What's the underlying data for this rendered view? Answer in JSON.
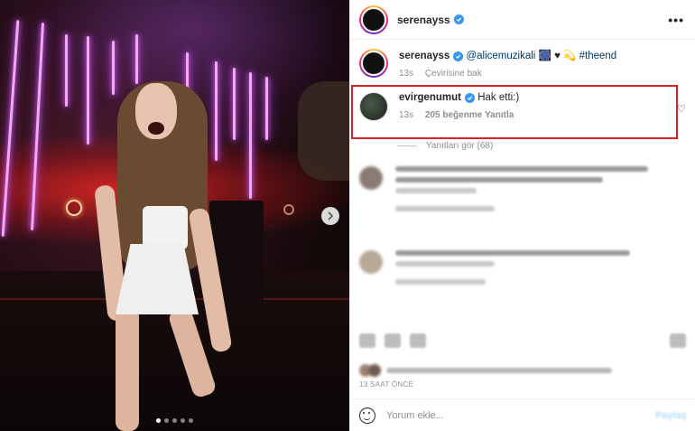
{
  "post": {
    "username": "serenayss",
    "more_icon": "more-horizontal-icon",
    "carousel_dots_total": 5,
    "carousel_dots_active": 1
  },
  "caption": {
    "username": "serenayss",
    "mention": "@alicemuzikali",
    "emojis": "🎆 ♥ 💫",
    "hashtag": "#theend",
    "time": "13s",
    "translate": "Çevirisine bak"
  },
  "highlighted_comment": {
    "username": "evirgenumut",
    "text": "Hak etti:)",
    "time": "13s",
    "likes": "205 beğenme",
    "reply": "Yanıtla",
    "view_replies": "Yanıtları gör (68)"
  },
  "footer": {
    "time_ago": "13 SAAT ÖNCE",
    "comment_placeholder": "Yorum ekle...",
    "post_button": "Paylaş"
  },
  "colors": {
    "verified": "#3897f0",
    "highlight_border": "#d2232a",
    "link": "#00376b"
  }
}
